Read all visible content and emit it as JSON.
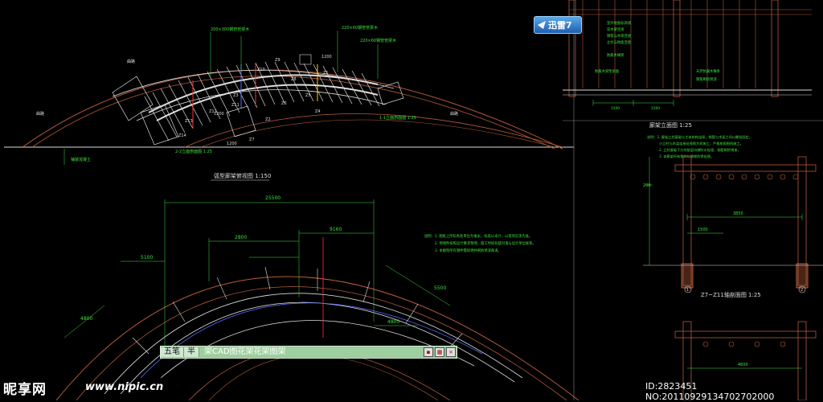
{
  "drawing": {
    "plan_title": "弧型廊架俯视图  1:150",
    "elevation_title": "廊架立面图  1:25",
    "section_title": "Z7~Z11轴剖面图  1:25",
    "top_labels": {
      "beam1": "200×300钢管管梁木",
      "beam2": "220×60钢管管梁木",
      "beam3": "220×60钢管管梁木",
      "kerb_left": "曲路",
      "kerb_left2": "曲路",
      "kerb_right": "曲路",
      "floor_label": "1-1立面剖面图 1:25",
      "floor_label2": "2-2立面剖面图 1:25",
      "ground": "铺装混凝土"
    },
    "axis_labels": [
      "Z13",
      "Z12",
      "Z11",
      "Z10",
      "Z9",
      "Z8",
      "Z7",
      "Z6",
      "Z5",
      "Z4",
      "Z3",
      "Z2",
      "Z1",
      "Z14",
      "1200",
      "1200",
      "1200"
    ],
    "plan_dims": {
      "total": "25500",
      "d1": "9160",
      "d2": "2800",
      "d3": "5100",
      "d4": "4800",
      "d5": "5500",
      "d6": "4800"
    },
    "notes_plan": [
      "说明：1. 图纸上所标各处单位为毫米，标高以米计，以现场实测为准。",
      "2. 预埋件按照设计要求预埋，施工时如有疑问请与设计单位联系。",
      "3. 本廊架所有钢件需除锈并刷防锈漆两道。"
    ],
    "notes_elev": [
      "说明：1. 廊架立柱基础与主体结构连接，钢管与木梁之间以螺栓固定。",
      "小立柱与木梁连接处按照大样施工，严格按照图纸施工。",
      "2. 立柱基础下方的垫层均做防水处理，钢管刷防锈漆。",
      "3. 本廊架所有钢件均需做防锈处理。"
    ],
    "elev_labels": {
      "l1": "室外地面标高线",
      "l2": "双木梁连接",
      "l3": "钢管与木梁连接",
      "l4": "立柱与地面连接",
      "l5": "防腐木横梁",
      "l6": "防腐木梁架剖面",
      "l7": "天然防腐木横条",
      "l8": "钢管刷防锈漆",
      "d1": "1500",
      "d2": "1500"
    },
    "section_dims": {
      "span": "3850",
      "left": "200",
      "b1": "1500",
      "bottom": "4600",
      "n1": "1",
      "n2": "2"
    }
  },
  "overlay": {
    "ime": {
      "mode": "五笔",
      "width": "半",
      "composition": "架CAD图花架花架图架"
    },
    "xunlei": {
      "label": "迅雷7"
    }
  },
  "watermark": {
    "logo": "昵享网",
    "url": "www.nipic.cn",
    "id": "ID:2823451 NO:20110929134702702000"
  },
  "colors": {
    "arc": "#b55a3a",
    "structure": "#ffffff",
    "dim": "#3fe03f",
    "accent": "#ff3030",
    "frame": "#a0a0a0",
    "blue": "#5a6aff"
  }
}
